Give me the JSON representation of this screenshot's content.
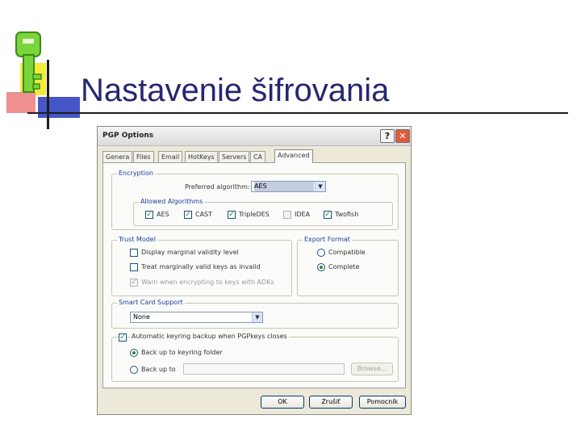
{
  "slide": {
    "title": "Nastavenie šifrovania"
  },
  "dialog": {
    "title": "PGP Options",
    "help_button": "?",
    "close_button": "✕",
    "tabs": [
      "Genera",
      "Files",
      "Email",
      "HotKeys",
      "Servers",
      "CA",
      "Advanced"
    ],
    "active_tab": "Advanced",
    "encryption": {
      "group_label": "Encryption",
      "preferred_label": "Preferred algorithm:",
      "preferred_value": "AES",
      "allowed_group_label": "Allowed Algorithms",
      "algorithms": [
        {
          "label": "AES",
          "checked": true,
          "enabled": true
        },
        {
          "label": "CAST",
          "checked": true,
          "enabled": true
        },
        {
          "label": "TripleDES",
          "checked": true,
          "enabled": true
        },
        {
          "label": "IDEA",
          "checked": false,
          "enabled": false
        },
        {
          "label": "Twofish",
          "checked": true,
          "enabled": true
        }
      ]
    },
    "trust_model": {
      "group_label": "Trust Model",
      "options": [
        {
          "label": "Display marginal validity level",
          "checked": false,
          "enabled": true
        },
        {
          "label": "Treat marginally valid keys as invalid",
          "checked": false,
          "enabled": true
        },
        {
          "label": "Warn when encrypting to keys with ADKs",
          "checked": true,
          "enabled": false
        }
      ]
    },
    "export_format": {
      "group_label": "Export Format",
      "options": [
        {
          "label": "Compatible",
          "selected": false
        },
        {
          "label": "Complete",
          "selected": true
        }
      ]
    },
    "smart_card": {
      "group_label": "Smart Card Support",
      "value": "None"
    },
    "backup": {
      "checkbox_label": "Automatic keyring backup when PGPkeys closes",
      "checked": true,
      "options": [
        {
          "label": "Back up to keyring folder",
          "selected": true
        },
        {
          "label": "Back up to",
          "selected": false
        }
      ],
      "browse_label": "Browse..."
    },
    "buttons": {
      "ok": "OK",
      "cancel": "Zrušiť",
      "help": "Pomocník"
    }
  }
}
